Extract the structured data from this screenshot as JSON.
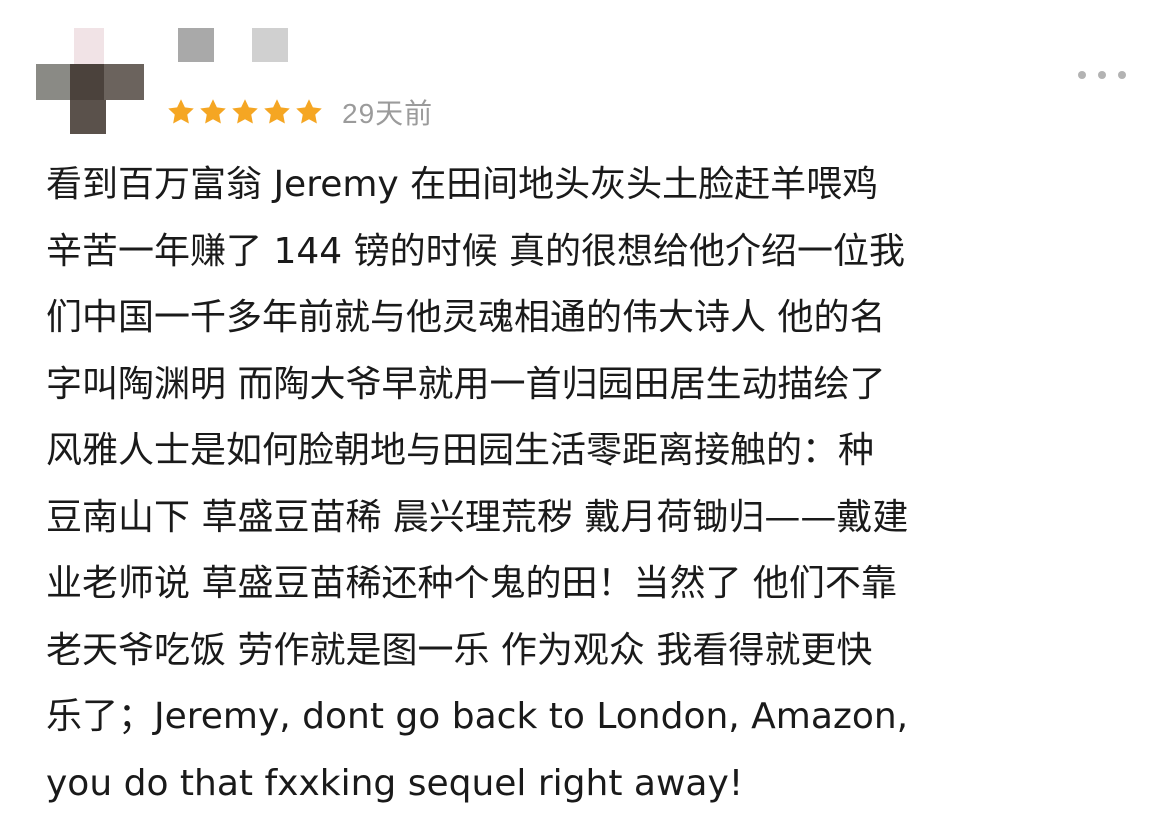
{
  "review": {
    "rating": 5,
    "max_rating": 5,
    "time_ago": "29天前",
    "star_color": "#F5A623",
    "more_icon": "more-horizontal-icon",
    "lines": [
      "看到百万富翁 Jeremy 在田间地头灰头土脸赶羊喂鸡",
      "辛苦一年赚了 144 镑的时候 真的很想给他介绍一位我",
      "们中国一千多年前就与他灵魂相通的伟大诗人 他的名",
      "字叫陶渊明 而陶大爷早就用一首归园田居生动描绘了",
      "风雅人士是如何脸朝地与田园生活零距离接触的：种",
      "豆南山下 草盛豆苗稀 晨兴理荒秽 戴月荷锄归——戴建",
      "业老师说 草盛豆苗稀还种个鬼的田！当然了 他们不靠",
      "老天爷吃饭 劳作就是图一乐 作为观众 我看得就更快",
      "乐了；Jeremy, dont go back to London, Amazon,",
      "you do that fxxking sequel right away!"
    ]
  }
}
